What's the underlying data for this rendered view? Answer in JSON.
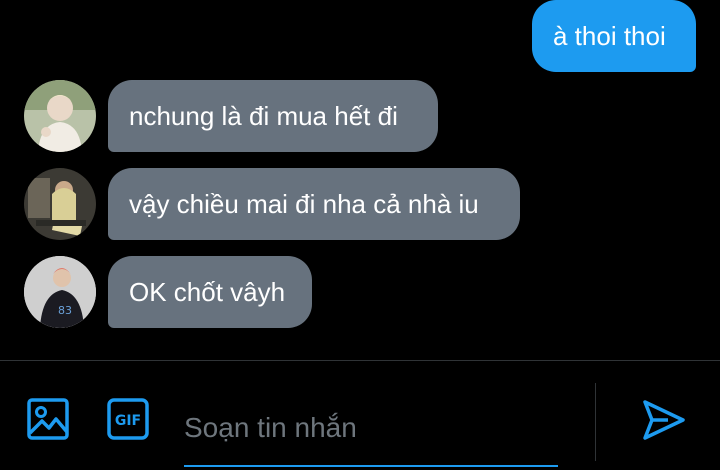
{
  "colors": {
    "background": "#000000",
    "accent": "#1d9bf0",
    "incoming_bubble": "#67727e",
    "placeholder": "#6e767d",
    "divider": "#2f3336"
  },
  "messages": [
    {
      "direction": "outgoing",
      "text": "à thoi thoi"
    },
    {
      "direction": "incoming",
      "text": "nchung là đi mua hết đi",
      "avatar": "user-avatar-1"
    },
    {
      "direction": "incoming",
      "text": "vậy chiều mai đi nha cả nhà iu",
      "avatar": "user-avatar-2"
    },
    {
      "direction": "incoming",
      "text": "OK chốt vâyh",
      "avatar": "user-avatar-3"
    }
  ],
  "composer": {
    "placeholder": "Soạn tin nhắn",
    "value": "",
    "image_icon": "image-icon",
    "gif_icon": "gif-icon",
    "gif_label": "GIF",
    "send_icon": "send-icon"
  }
}
